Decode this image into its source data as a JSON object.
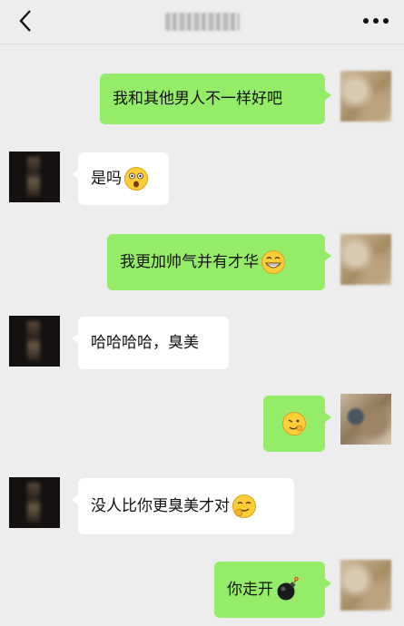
{
  "header": {
    "back_icon": "chevron-left-icon",
    "more_icon": "more-horizontal-icon"
  },
  "messages": [
    {
      "side": "me",
      "text": "我和其他男人不一样好吧"
    },
    {
      "side": "her",
      "text": "是吗",
      "emoji": "shocked-face-icon"
    },
    {
      "side": "me",
      "text": "我更加帅气并有才华",
      "emoji": "grin-face-icon"
    },
    {
      "side": "her",
      "text": "哈哈哈哈，臭美"
    },
    {
      "side": "me",
      "text": "",
      "emoji": "sly-face-icon"
    },
    {
      "side": "her",
      "text": "没人比你更臭美才对",
      "emoji": "snicker-face-icon"
    },
    {
      "side": "me",
      "text": "你走开",
      "emoji": "bomb-icon"
    }
  ],
  "colors": {
    "background": "#ededed",
    "my_bubble": "#95ec69",
    "their_bubble": "#ffffff"
  }
}
